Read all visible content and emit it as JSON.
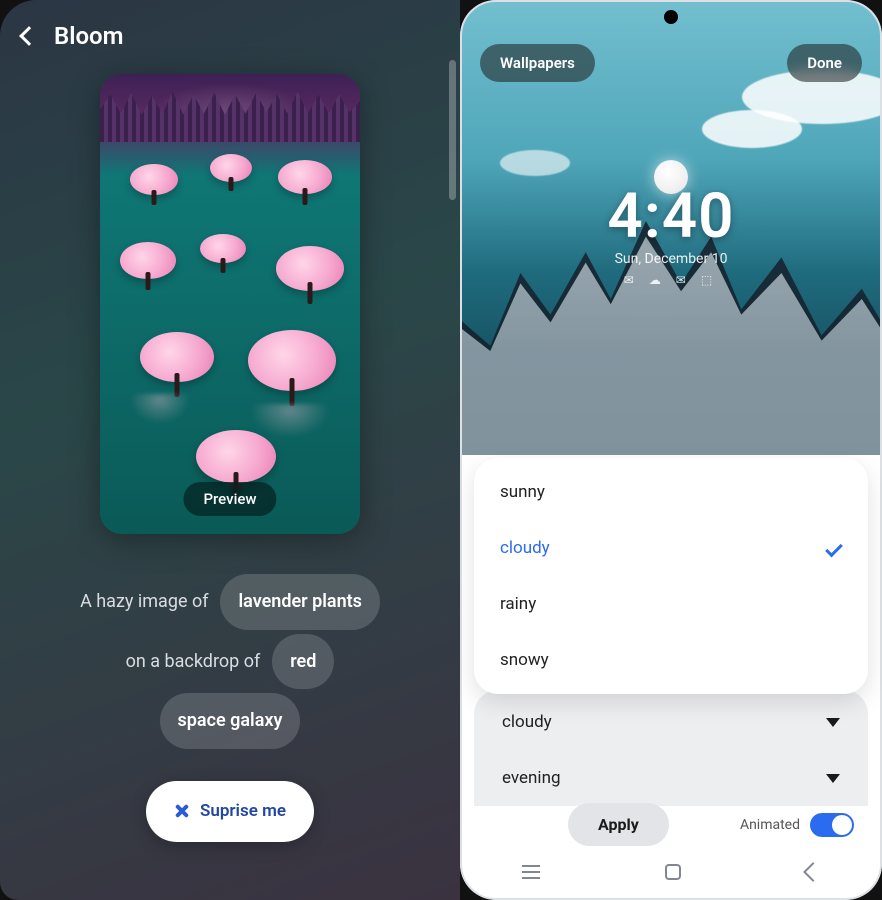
{
  "left": {
    "title": "Bloom",
    "preview_label": "Preview",
    "prompt": {
      "line1_prefix": "A hazy image of",
      "chip_subject": "lavender plants",
      "line2_prefix": "on a backdrop of",
      "chip_color": "red",
      "chip_scene": "space galaxy"
    },
    "surprise_label": "Suprise me"
  },
  "right": {
    "top_left_pill": "Wallpapers",
    "top_right_pill": "Done",
    "clock_time": "4:40",
    "clock_date": "Sun, December 10",
    "weather_options": [
      {
        "label": "sunny",
        "selected": false
      },
      {
        "label": "cloudy",
        "selected": true
      },
      {
        "label": "rainy",
        "selected": false
      },
      {
        "label": "snowy",
        "selected": false
      }
    ],
    "select_weather": "cloudy",
    "select_time": "evening",
    "apply_label": "Apply",
    "animated_label": "Animated",
    "animated_on": true
  }
}
